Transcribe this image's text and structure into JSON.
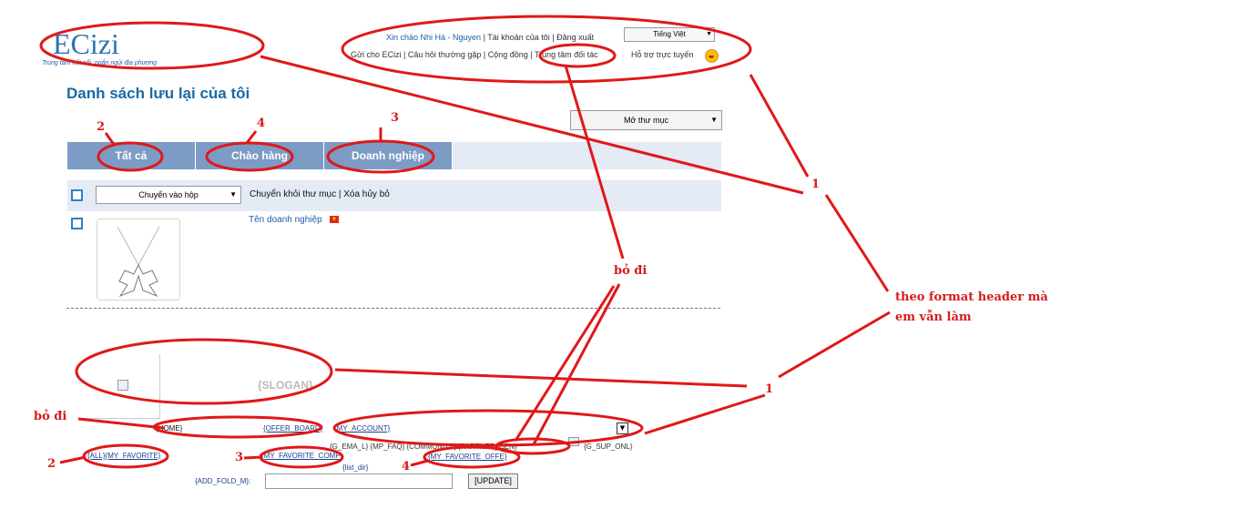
{
  "header": {
    "logo_text": "ECizi",
    "tagline": "Trung tâm kết nối, ngắn ngủi địa phương",
    "greeting": "Xin chào Nhi Hà - Nguyen",
    "account": "Tài khoản của tôi",
    "logout": "Đăng xuất",
    "language": "Tiếng Việt",
    "nav_links": [
      "Gửi cho ECizi",
      "Câu hỏi thường gặp",
      "Cộng đồng",
      "Trung tâm đối tác"
    ],
    "support": "Hỗ trợ trực tuyến"
  },
  "page": {
    "title": "Danh sách lưu lại của tôi",
    "folder_select": "Mở thư mục"
  },
  "tabs": [
    "Tất cả",
    "Chào hàng",
    "Doanh nghiệp"
  ],
  "actions": {
    "move_select": "Chuyển vào hộp",
    "move_out": "Chuyển khỏi thư mục",
    "remove": "Xóa hủy bỏ"
  },
  "item": {
    "company": "Tên doanh nghiệp"
  },
  "template": {
    "slogan": "{SLOGAN}",
    "home": "{HOME}",
    "offer_board": "{OFFER_BOARD}",
    "my_account": "{MY_ACCOUNT}",
    "links_row": "{G_EMA_L}  {MP_FAQ}  {COMMUNITY}  {PARTNER_CEN}",
    "sup_onl": "{G_SUP_ONL}",
    "all_fav": "{ALL}{MY_FAVORITE}",
    "fav_comp": "{MY_FAVORITE_COMP}",
    "fav_offer": "{MY_FAVORITE_OFFE}",
    "list_dir": "{list_dir}",
    "add_fold": "{ADD_FOLD_M}:",
    "update": "[UPDATE]"
  },
  "annotations": {
    "n1a": "1",
    "n1b": "1",
    "n2a": "2",
    "n2b": "2",
    "n3a": "3",
    "n3b": "3",
    "n4a": "4",
    "n4b": "4",
    "remove_a": "bỏ đi",
    "remove_b": "bỏ đi",
    "note_line1": "theo format header mà",
    "note_line2": "em vẫn làm"
  }
}
